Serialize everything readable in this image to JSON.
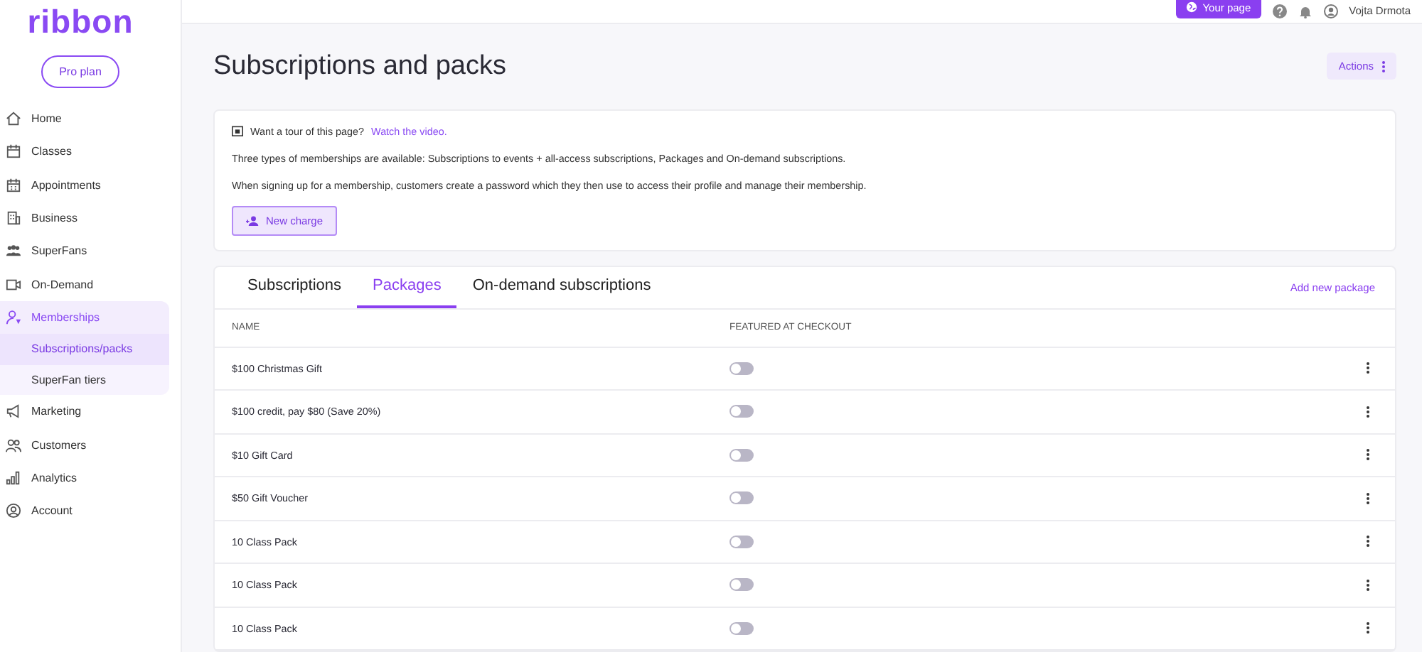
{
  "sidebar": {
    "logo": "ribbon",
    "plan_button": "Pro plan",
    "items": [
      {
        "label": "Home",
        "expanded": false
      },
      {
        "label": "Classes",
        "expanded": false
      },
      {
        "label": "Appointments",
        "expanded": false
      },
      {
        "label": "Business",
        "expanded": false
      },
      {
        "label": "SuperFans",
        "expanded": false
      },
      {
        "label": "On-Demand",
        "expanded": false
      },
      {
        "label": "Memberships",
        "expanded": true,
        "children": [
          {
            "label": "Subscriptions/packs",
            "selected": true
          },
          {
            "label": "SuperFan tiers",
            "selected": false
          }
        ]
      },
      {
        "label": "Marketing",
        "expanded": false
      },
      {
        "label": "Customers",
        "expanded": false
      },
      {
        "label": "Analytics",
        "expanded": false
      },
      {
        "label": "Account",
        "expanded": false
      }
    ]
  },
  "top_bar": {
    "page_button": "Your page",
    "user_name": "Vojta Drmota"
  },
  "page_title": "Subscriptions and packs",
  "actions_button": "Actions",
  "info_card": {
    "tour_text": "Want a tour of this page?",
    "tour_link": "Watch the video.",
    "paragraphs": [
      "Three types of memberships are available: Subscriptions to events + all-access subscriptions, Packages and On-demand subscriptions.",
      "When signing up for a membership, customers create a password which they then use to access their profile and manage their membership."
    ],
    "button": "New charge"
  },
  "tabs": [
    {
      "label": "Subscriptions",
      "selected": false
    },
    {
      "label": "Packages",
      "selected": true
    },
    {
      "label": "On-demand subscriptions",
      "selected": false
    }
  ],
  "add_link": "Add new package",
  "table": {
    "columns": [
      "NAME",
      "FEATURED AT CHECKOUT"
    ],
    "rows": [
      {
        "name": "$100 Christmas Gift",
        "featured": false
      },
      {
        "name": "$100 credit, pay $80 (Save 20%)",
        "featured": false
      },
      {
        "name": "$10 Gift Card",
        "featured": false
      },
      {
        "name": "$50 Gift Voucher",
        "featured": false
      },
      {
        "name": "10 Class Pack",
        "featured": false
      },
      {
        "name": "10 Class Pack",
        "featured": false
      },
      {
        "name": "10 Class Pack",
        "featured": false
      }
    ]
  }
}
